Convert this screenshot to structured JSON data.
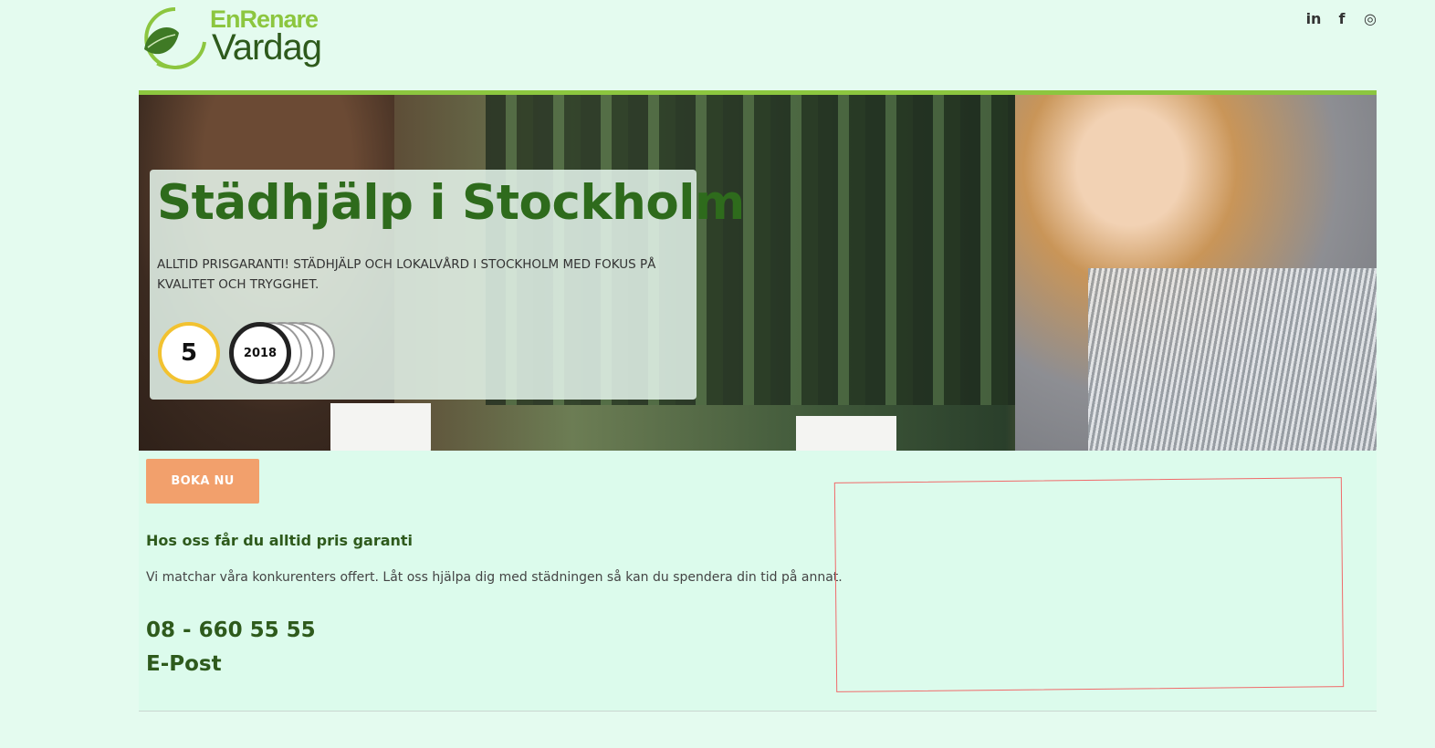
{
  "header": {
    "logo_top": "EnRenare",
    "logo_bottom": "Vardag",
    "social": [
      {
        "icon": "linkedin-icon",
        "glyph": "in"
      },
      {
        "icon": "facebook-icon",
        "glyph": "f"
      },
      {
        "icon": "instagram-icon",
        "glyph": "◎"
      }
    ]
  },
  "hero": {
    "title": "Städhjälp i Stockholm",
    "subtitle": "ALLTID PRISGARANTI! STÄDHJÄLP OCH LOKALVÅRD I STOCKHOLM MED FOKUS PÅ KVALITET OCH TRYGGHET.",
    "badge_years": "5",
    "badge_year": "2018"
  },
  "main": {
    "book_button": "BOKA NU",
    "guarantee_title": "Hos oss får du alltid pris garanti",
    "guarantee_text": "Vi matchar våra konkurenters offert. Låt oss hjälpa dig med städningen så kan du spendera din tid på annat.",
    "phone": "08 - 660 55 55",
    "email": "E-Post"
  },
  "colors": {
    "brand_green": "#2e5a1c",
    "accent_green": "#8cc63f",
    "button_orange": "#f2a06c",
    "page_bg": "#e4fbef"
  }
}
